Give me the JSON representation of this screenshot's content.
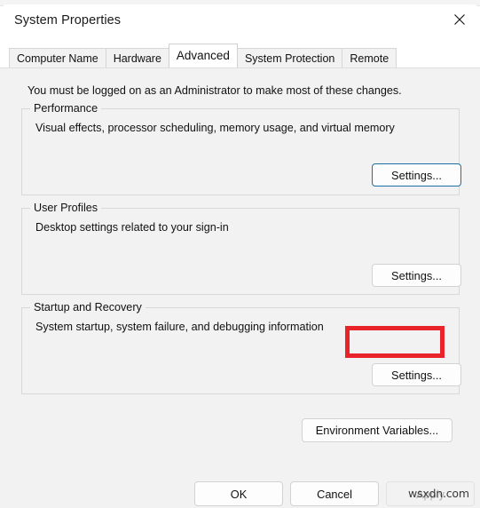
{
  "window": {
    "title": "System Properties",
    "close_icon": "close-icon",
    "behind_window_hint": "  "
  },
  "tabs": [
    {
      "label": "Computer Name",
      "active": false
    },
    {
      "label": "Hardware",
      "active": false
    },
    {
      "label": "Advanced",
      "active": true
    },
    {
      "label": "System Protection",
      "active": false
    },
    {
      "label": "Remote",
      "active": false
    }
  ],
  "main": {
    "admin_note": "You must be logged on as an Administrator to make most of these changes.",
    "groups": [
      {
        "legend": "Performance",
        "description": "Visual effects, processor scheduling, memory usage, and virtual memory",
        "button_label": "Settings..."
      },
      {
        "legend": "User Profiles",
        "description": "Desktop settings related to your sign-in",
        "button_label": "Settings..."
      },
      {
        "legend": "Startup and Recovery",
        "description": "System startup, system failure, and debugging information",
        "button_label": "Settings..."
      }
    ],
    "environment_variables_label": "Environment Variables..."
  },
  "footer": {
    "ok_label": "OK",
    "cancel_label": "Cancel",
    "apply_label": "Apply"
  },
  "annotation": {
    "highlight_color": "#e8232a",
    "focus_color": "#1f6fa5",
    "target": "User Profiles Settings..."
  },
  "watermark": {
    "text": "wsxdn.com"
  }
}
